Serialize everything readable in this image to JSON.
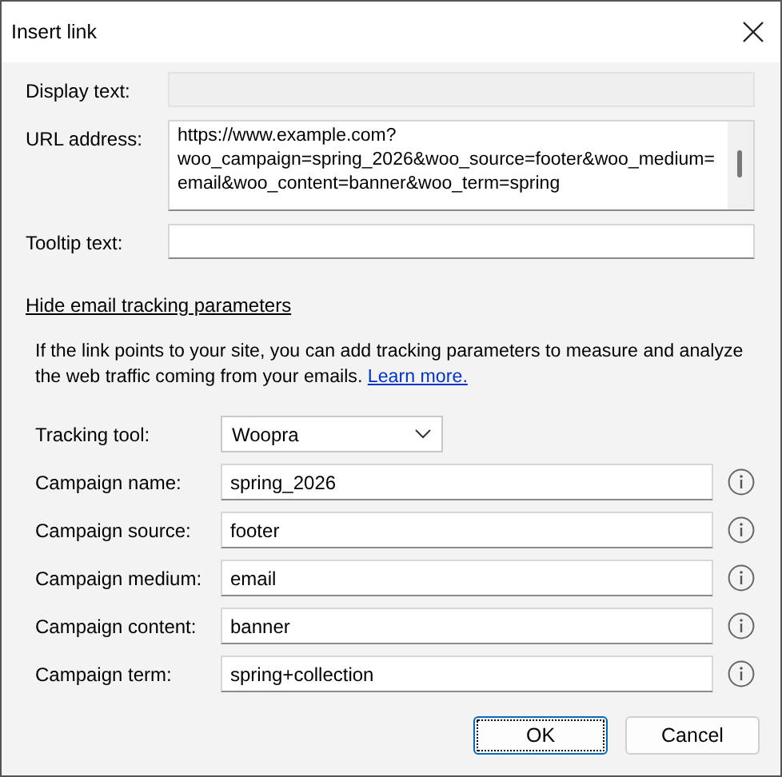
{
  "window": {
    "title": "Insert link"
  },
  "fields": [
    {
      "label": "Display text:",
      "kind": "text",
      "disabled": true
    },
    {
      "label": "URL address:",
      "kind": "multiline",
      "value": "https://www.example.com?woo_campaign=spring_2026&woo_source=footer&woo_medium=email&woo_content=banner&woo_term=spring",
      "disabled": false
    },
    {
      "label": "Tooltip text:",
      "kind": "text",
      "disabled": false
    }
  ],
  "toggle_link": "Hide email tracking parameters",
  "description": {
    "text": "If the link points to your site, you can add tracking parameters to measure and analyze the web traffic coming from your emails.",
    "link": "Learn more."
  },
  "tracking_tool": {
    "label": "Tracking tool:",
    "value": "Woopra"
  },
  "parameters": [
    {
      "label": "Campaign name:",
      "value": "spring_2026"
    },
    {
      "label": "Campaign source:",
      "value": "footer"
    },
    {
      "label": "Campaign medium:",
      "value": "email"
    },
    {
      "label": "Campaign content:",
      "value": "banner"
    },
    {
      "label": "Campaign term:",
      "value": "spring+collection"
    }
  ],
  "buttons": [
    {
      "label": "OK",
      "default": true
    },
    {
      "label": "Cancel",
      "default": false
    }
  ]
}
